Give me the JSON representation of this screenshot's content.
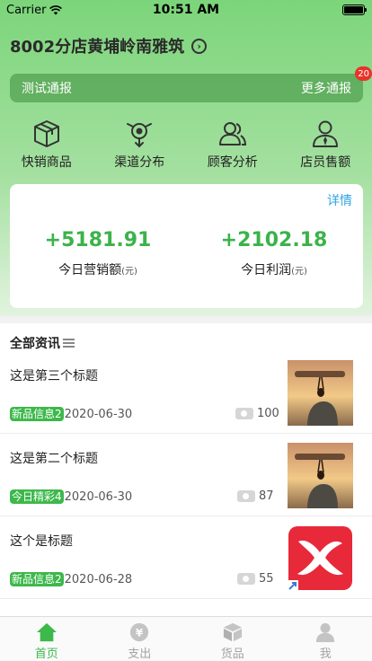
{
  "status_bar": {
    "carrier": "Carrier",
    "time": "10:51 AM"
  },
  "header": {
    "store_name": "8002分店黄埔岭南雅筑"
  },
  "notice": {
    "label": "测试通报",
    "more": "更多通报",
    "badge_count": "20"
  },
  "quick_menu": [
    {
      "label": "快销商品",
      "icon": "package-icon"
    },
    {
      "label": "渠道分布",
      "icon": "channel-icon"
    },
    {
      "label": "顾客分析",
      "icon": "customers-icon"
    },
    {
      "label": "店员售额",
      "icon": "clerk-icon"
    }
  ],
  "stats": {
    "details": "详情",
    "sales_value": "+5181.91",
    "sales_label": "今日营销额",
    "sales_unit": "(元)",
    "profit_value": "+2102.18",
    "profit_label": "今日利润",
    "profit_unit": "(元)"
  },
  "news": {
    "header": "全部资讯",
    "items": [
      {
        "title": "这是第三个标题",
        "tag": "新品信息2",
        "date": "2020-06-30",
        "views": "100",
        "thumb": "ant-photo"
      },
      {
        "title": "这是第二个标题",
        "tag": "今日精彩4",
        "date": "2020-06-30",
        "views": "87",
        "thumb": "ant-photo"
      },
      {
        "title": "这个是标题",
        "tag": "新品信息2",
        "date": "2020-06-28",
        "views": "55",
        "thumb": "xmind-logo"
      }
    ]
  },
  "tabs": [
    {
      "label": "首页",
      "icon": "home-icon",
      "active": true
    },
    {
      "label": "支出",
      "icon": "yen-icon",
      "active": false
    },
    {
      "label": "货品",
      "icon": "box-icon",
      "active": false
    },
    {
      "label": "我",
      "icon": "user-icon",
      "active": false
    }
  ],
  "colors": {
    "accent": "#3db84b",
    "link": "#2fa3e4",
    "badge": "#e8332a"
  }
}
